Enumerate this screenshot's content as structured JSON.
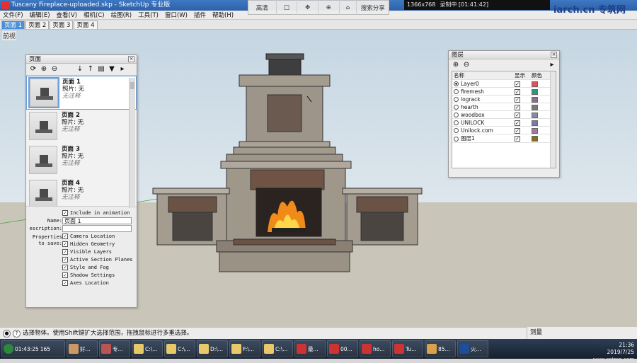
{
  "window": {
    "title": "Tuscany Fireplace-uploaded.skp - SketchUp 专业版"
  },
  "menu": [
    "文件(F)",
    "编辑(E)",
    "查看(V)",
    "相机(C)",
    "绘图(R)",
    "工具(T)",
    "窗口(W)",
    "插件",
    "帮助(H)"
  ],
  "scene_tabs": [
    "页面 1",
    "页面 2",
    "页面 3",
    "页面 4"
  ],
  "overlay": {
    "items": [
      "高清",
      "",
      "",
      "",
      "",
      "搜索分享"
    ]
  },
  "recorder": {
    "resolution": "1366x768",
    "status": "录制中 [01:41:42]"
  },
  "watermark": "iarch.cn 专筑网",
  "viewport": {
    "scene_label": "前视"
  },
  "scenes_panel": {
    "title": "页面",
    "scenes": [
      {
        "name": "页面 1",
        "photo": "照片: 无",
        "note": "无注释"
      },
      {
        "name": "页面 2",
        "photo": "照片: 无",
        "note": "无注释"
      },
      {
        "name": "页面 3",
        "photo": "照片: 无",
        "note": "无注释"
      },
      {
        "name": "页面 4",
        "photo": "照片: 无",
        "note": "无注释"
      }
    ],
    "include_label": "Include in animation",
    "name_label": "Name:",
    "name_value": "页面 1",
    "desc_label": "escription:",
    "props_label": "Properties to save:",
    "props": [
      "Camera Location",
      "Hidden Geometry",
      "Visible Layers",
      "Active Section Planes",
      "Style and Fog",
      "Shadow Settings",
      "Axes Location"
    ]
  },
  "layers_panel": {
    "title": "图层",
    "col_name": "名称",
    "col_visible": "显示",
    "col_color": "颜色",
    "layers": [
      {
        "name": "Layer0",
        "active": true,
        "color": "#e05454"
      },
      {
        "name": "firemesh",
        "active": false,
        "color": "#2a9a7a"
      },
      {
        "name": "lograck",
        "active": false,
        "color": "#8a6f8f"
      },
      {
        "name": "hearth",
        "active": false,
        "color": "#7a7a7a"
      },
      {
        "name": "woodbox",
        "active": false,
        "color": "#8a8aa6"
      },
      {
        "name": "UNILOCK",
        "active": false,
        "color": "#7a7aa8"
      },
      {
        "name": "Unilock.com",
        "active": false,
        "color": "#a07aa0"
      },
      {
        "name": "图层1",
        "active": false,
        "color": "#8a6a20"
      }
    ]
  },
  "status": {
    "text": "选择物体。使用Shift键扩大选择范围，拖拽鼠标进行多重选择。",
    "measure_label": "测量"
  },
  "taskbar": {
    "timer": "01:43:25",
    "count": "165",
    "items": [
      "好...",
      "专...",
      "C:\\...",
      "C:\\...",
      "D:\\...",
      "F:\\...",
      "C:\\...",
      "最...",
      "00...",
      "ho...",
      "Tu...",
      "85...",
      "火..."
    ],
    "time": "21:36",
    "date": "2019/7/25",
    "tray_watermark": "www.cntren.com"
  }
}
